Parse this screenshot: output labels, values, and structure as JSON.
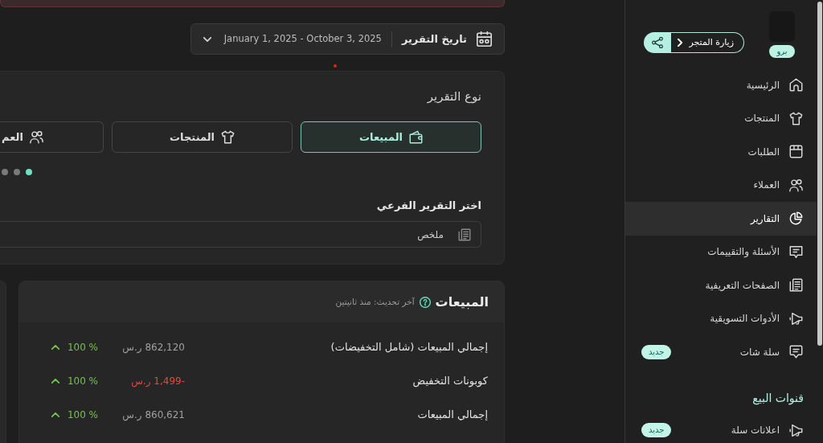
{
  "sidebar": {
    "plan_badge": "برو",
    "visit_store": "زيارة المتجر",
    "items": [
      {
        "label": "الرئيسية",
        "selected": false
      },
      {
        "label": "المنتجات",
        "selected": false
      },
      {
        "label": "الطلبات",
        "selected": false
      },
      {
        "label": "العملاء",
        "selected": false
      },
      {
        "label": "التقارير",
        "selected": true
      },
      {
        "label": "الأسئلة والتقييمات",
        "selected": false
      },
      {
        "label": "الصفحات التعريفية",
        "selected": false
      },
      {
        "label": "الأدوات التسويقية",
        "selected": false
      },
      {
        "label": "سلة شات",
        "selected": false,
        "badge": "جديد"
      }
    ],
    "sections": [
      {
        "heading": "قنوات البيع",
        "items": [
          {
            "label": "اعلانات سلة",
            "selected": false,
            "badge": "جديد"
          }
        ]
      }
    ]
  },
  "date_filter": {
    "label": "تاريخ التقرير",
    "range": "January 1, 2025 - October 3, 2025"
  },
  "report_type": {
    "title": "نوع التقرير",
    "tabs": [
      {
        "label": "المبيعات",
        "selected": true
      },
      {
        "label": "المنتجات",
        "selected": false
      },
      {
        "label": "العم",
        "selected": false
      }
    ],
    "pager": [
      {
        "selected": true
      },
      {
        "selected": false
      },
      {
        "selected": false
      }
    ]
  },
  "sub_report": {
    "label": "اختر التقرير الفرعي",
    "value": "ملخص"
  },
  "sales_card": {
    "title": "المبيعات",
    "updated": "آخر تحديث: منذ ثانيتين",
    "rows": [
      {
        "label": "إجمالي المبيعات (شامل التخفيضات)",
        "amount": "862,120 ر.س",
        "negative": false,
        "change": "100 %",
        "rising": true
      },
      {
        "label": "كوبونات التخفيض",
        "amount": "-1,499 ر.س",
        "negative": true,
        "change": "100 %",
        "rising": true
      },
      {
        "label": "إجمالي المبيعات",
        "amount": "860,621 ر.س",
        "negative": false,
        "change": "100 %",
        "rising": true
      }
    ]
  }
}
